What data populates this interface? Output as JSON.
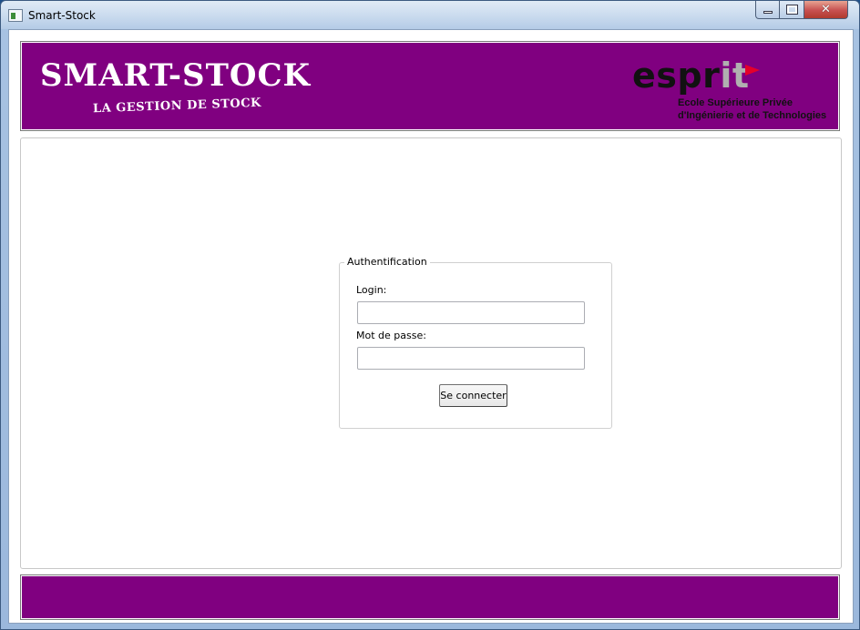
{
  "window": {
    "title": "Smart-Stock"
  },
  "controls": {
    "minimize_icon": "minimize-icon",
    "maximize_icon": "maximize-icon",
    "close_icon": "close-icon",
    "close_glyph": "✕"
  },
  "header": {
    "brand_title": "SMART-STOCK",
    "brand_subtitle": "LA GESTION DE STOCK",
    "logo": {
      "word_main": "espr",
      "word_accent": "it",
      "line1": "Ecole Supérieure Privée",
      "line2": "d'Ingénierie et de Technologies"
    },
    "background_color": "#800080"
  },
  "auth": {
    "legend": "Authentification",
    "login_label": "Login:",
    "login_value": "",
    "password_label": "Mot de passe:",
    "password_value": "",
    "submit_label": "Se connecter"
  },
  "footer": {
    "background_color": "#800080"
  }
}
